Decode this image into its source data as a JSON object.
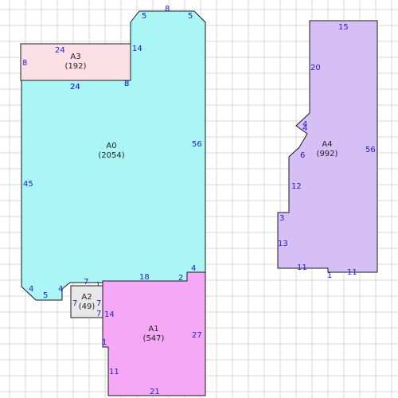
{
  "colors": {
    "background": "#ffffff",
    "grid": "#d9d9d9",
    "outline": "#1a1a1a",
    "dimension_text": "#1f1fd6",
    "label_text": "#222222"
  },
  "rooms": [
    {
      "id": "A0",
      "name": "A0",
      "area": "(2054)",
      "fill": "#aaf6f6",
      "dims": [
        "5",
        "8",
        "5",
        "14",
        "8",
        "24",
        "56",
        "45",
        "4",
        "5",
        "4",
        "7",
        "1",
        "18",
        "2",
        "4"
      ]
    },
    {
      "id": "A1",
      "name": "A1",
      "area": "(547)",
      "fill": "#f5a8f5",
      "dims": [
        "14",
        "27",
        "1",
        "11",
        "21"
      ]
    },
    {
      "id": "A2",
      "name": "A2",
      "area": "(49)",
      "fill": "#e8e8e8",
      "dims": [
        "7",
        "7",
        "7"
      ]
    },
    {
      "id": "A3",
      "name": "A3",
      "area": "(192)",
      "fill": "#fce0e6",
      "dims": [
        "24",
        "8",
        "8",
        "24"
      ]
    },
    {
      "id": "A4",
      "name": "A4",
      "area": "(992)",
      "fill": "#d6bff5",
      "dims": [
        "15",
        "20",
        "4",
        "4",
        "6",
        "56",
        "12",
        "3",
        "13",
        "11",
        "1",
        "11"
      ]
    }
  ]
}
